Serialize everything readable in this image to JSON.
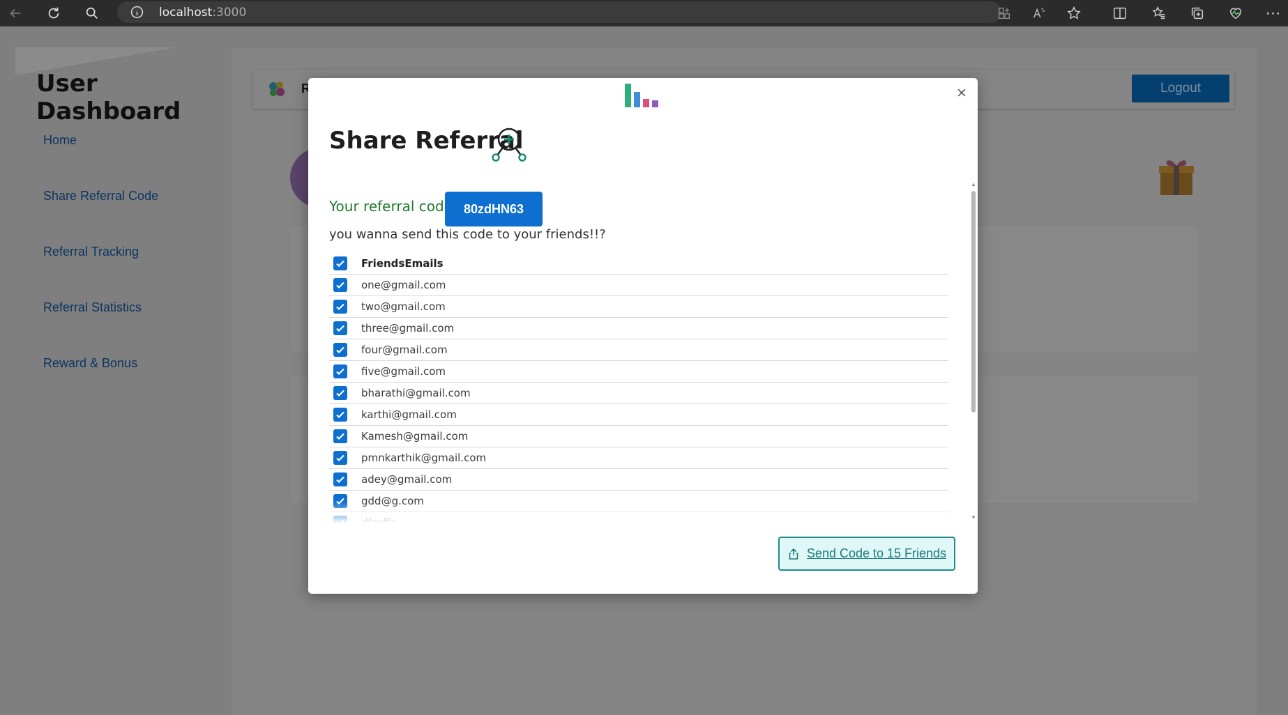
{
  "browser": {
    "url_host": "localhost",
    "url_port": ":3000"
  },
  "sidebar": {
    "title_line1": "User",
    "title_line2": "Dashboard",
    "items": [
      {
        "label": "Home"
      },
      {
        "label": "Share Referral Code"
      },
      {
        "label": "Referral Tracking"
      },
      {
        "label": "Referral Statistics"
      },
      {
        "label": "Reward & Bonus"
      }
    ]
  },
  "header": {
    "logo_initial": "R",
    "logout_label": "Logout"
  },
  "modal": {
    "title": "Share Referral",
    "code_label": "Your referral code:",
    "code_value": "80zdHN63",
    "prompt": "you wanna send this code to your friends!!?",
    "table_header": "FriendsEmails",
    "emails": [
      "one@gmail.com",
      "two@gmail.com",
      "three@gmail.com",
      "four@gmail.com",
      "five@gmail.com",
      "bharathi@gmail.com",
      "karthi@gmail.com",
      "Kamesh@gmail.com",
      "pmnkarthik@gmail.com",
      "adey@gmail.com",
      "gdd@g.com",
      "dfasffa"
    ],
    "send_label": "Send Code to 15 Friends"
  },
  "colors": {
    "primary_blue": "#0d6fcf",
    "teal": "#1e8a8c",
    "code_label_green": "#207b2a"
  }
}
